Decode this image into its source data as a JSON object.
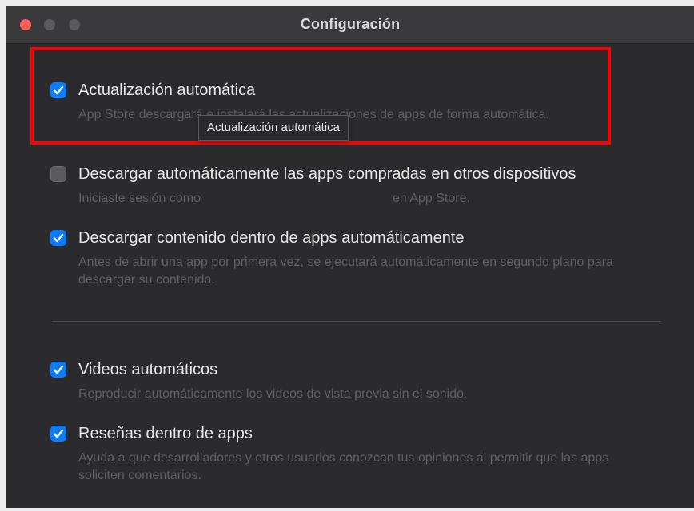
{
  "window": {
    "title": "Configuración"
  },
  "options": [
    {
      "label": "Actualización automática",
      "checked": true,
      "description": "App Store descargará e instalará las actualizaciones de apps de forma automática."
    },
    {
      "label": "Descargar automáticamente las apps compradas en otros dispositivos",
      "checked": false,
      "description_before": "Iniciaste sesión como",
      "description_after": "en App Store."
    },
    {
      "label": "Descargar contenido dentro de apps automáticamente",
      "checked": true,
      "description": "Antes de abrir una app por primera vez, se ejecutará automáticamente en segundo plano para descargar su contenido."
    },
    {
      "label": "Videos automáticos",
      "checked": true,
      "description": "Reproducir automáticamente los videos de vista previa sin el sonido."
    },
    {
      "label": "Reseñas dentro de apps",
      "checked": true,
      "description": "Ayuda a que desarrolladores y otros usuarios conozcan tus opiniones al permitir que las apps soliciten comentarios."
    }
  ],
  "tooltip": {
    "text": "Actualización automática"
  },
  "colors": {
    "accent": "#0a7cff",
    "highlight": "#ff0000",
    "close": "#ff5f57"
  },
  "icons": {
    "checkmark": "checkmark-icon"
  }
}
